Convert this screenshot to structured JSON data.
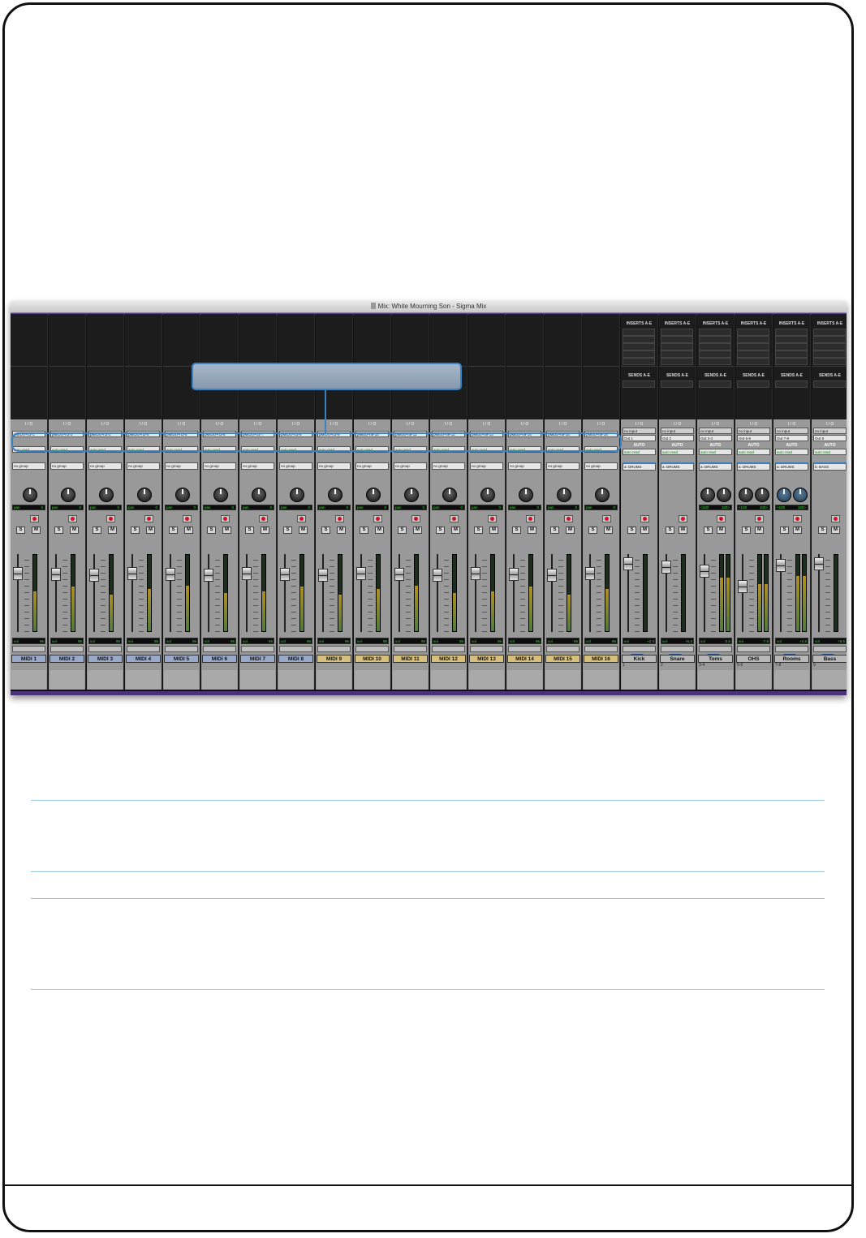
{
  "window": {
    "title": "Mix: White Mourning Son - Sigma Mix"
  },
  "labels": {
    "inserts": "INSERTS A-E",
    "sends": "SENDS A-E",
    "io": "I / O",
    "auto": "AUTO",
    "pan": "pan",
    "vol": "vol",
    "solo": "S",
    "mute": "M",
    "dyn": "dyn"
  },
  "midi_strips": [
    {
      "name": "MIDI 1",
      "output": "pMIDI,Prt3-1",
      "automation": "auto read",
      "group": "no group",
      "pan": "0",
      "vol": "96",
      "name_color": "blue"
    },
    {
      "name": "MIDI 2",
      "output": "pMIDI,Prt3-2",
      "automation": "auto read",
      "group": "no group",
      "pan": "0",
      "vol": "96",
      "name_color": "blue"
    },
    {
      "name": "MIDI 3",
      "output": "pMIDI,Prt3-3",
      "automation": "auto read",
      "group": "no group",
      "pan": "0",
      "vol": "96",
      "name_color": "blue"
    },
    {
      "name": "MIDI 4",
      "output": "pMIDI,Prt3-4",
      "automation": "auto read",
      "group": "no group",
      "pan": "0",
      "vol": "96",
      "name_color": "blue"
    },
    {
      "name": "MIDI 5",
      "output": "pMIDI,Prt3-5",
      "automation": "auto read",
      "group": "no group",
      "pan": "0",
      "vol": "96",
      "name_color": "blue"
    },
    {
      "name": "MIDI 6",
      "output": "pMIDI,Prt3-6",
      "automation": "auto read",
      "group": "no group",
      "pan": "0",
      "vol": "96",
      "name_color": "blue"
    },
    {
      "name": "MIDI 7",
      "output": "pMIDI,Prt3-7",
      "automation": "auto read",
      "group": "no group",
      "pan": "0",
      "vol": "96",
      "name_color": "blue"
    },
    {
      "name": "MIDI 8",
      "output": "pMIDI,Prt3-8",
      "automation": "auto read",
      "group": "no group",
      "pan": "0",
      "vol": "96",
      "name_color": "blue"
    },
    {
      "name": "MIDI 9",
      "output": "pMIDI,Prt3-9",
      "automation": "auto read",
      "group": "no group",
      "pan": "0",
      "vol": "96",
      "name_color": "gold"
    },
    {
      "name": "MIDI 10",
      "output": "pMidi,Prt9-10",
      "automation": "auto read",
      "group": "no group",
      "pan": "0",
      "vol": "96",
      "name_color": "gold"
    },
    {
      "name": "MIDI 11",
      "output": "pMidi,Prt9-11",
      "automation": "auto read",
      "group": "no group",
      "pan": "0",
      "vol": "96",
      "name_color": "gold"
    },
    {
      "name": "MIDI 12",
      "output": "pMidi,Prt9-12",
      "automation": "auto read",
      "group": "no group",
      "pan": "0",
      "vol": "96",
      "name_color": "gold"
    },
    {
      "name": "MIDI 13",
      "output": "pMidi,Prt9-13",
      "automation": "auto read",
      "group": "no group",
      "pan": "0",
      "vol": "96",
      "name_color": "gold"
    },
    {
      "name": "MIDI 14",
      "output": "pMidi,Prt9-14",
      "automation": "auto read",
      "group": "no group",
      "pan": "0",
      "vol": "96",
      "name_color": "gold"
    },
    {
      "name": "MIDI 15",
      "output": "pMidi,Prt9-15",
      "automation": "auto read",
      "group": "no group",
      "pan": "0",
      "vol": "96",
      "name_color": "gold"
    },
    {
      "name": "MIDI 16",
      "output": "pMidi,Prt9-16",
      "automation": "auto read",
      "group": "no group",
      "pan": "0",
      "vol": "96",
      "name_color": "gold"
    }
  ],
  "audio_strips": [
    {
      "name": "Kick",
      "number": "1",
      "input": "no input",
      "output": "Out 1",
      "automation": "auto read",
      "group": "a: DRUMS",
      "vol": "+2.3",
      "stereo": false,
      "dyn": true
    },
    {
      "name": "Snare",
      "number": "2",
      "input": "no input",
      "output": "Out 2",
      "automation": "auto read",
      "group": "a: DRUMS",
      "vol": "+5.5",
      "stereo": false,
      "dyn": true
    },
    {
      "name": "Toms",
      "number": "3-4",
      "input": "no input",
      "output": "Out 3-4",
      "automation": "auto read",
      "group": "a: DRUMS",
      "vol": "-2.6",
      "stereo": true,
      "pan_l": "<100",
      "pan_r": "100>",
      "dyn": true
    },
    {
      "name": "OHS",
      "number": "5-6",
      "input": "no input",
      "output": "Out 5-6",
      "automation": "auto read",
      "group": "a: DRUMS",
      "vol": "-7.8",
      "stereo": true,
      "pan_l": "<100",
      "pan_r": "100>",
      "dyn": false
    },
    {
      "name": "Rooms",
      "number": "7-8",
      "input": "no input",
      "output": "Out 7-8",
      "automation": "auto read",
      "group": "a: DRUMS",
      "vol": "+2.8",
      "stereo": true,
      "pan_l": "<100",
      "pan_r": "100>",
      "dyn": true
    },
    {
      "name": "Bass",
      "number": "9",
      "input": "no input",
      "output": "Out 9",
      "automation": "auto read",
      "group": "b: BASS",
      "vol": "+6.5",
      "stereo": false,
      "dyn": true
    }
  ],
  "colors": {
    "callout": "#3a82c4",
    "window_accent": "#5b3e8a"
  }
}
